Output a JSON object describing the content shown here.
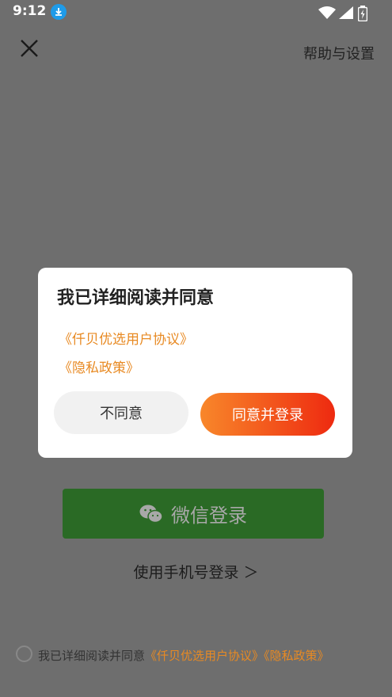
{
  "status_bar": {
    "time": "9:12"
  },
  "header": {
    "help_label": "帮助与设置"
  },
  "dialog": {
    "title": "我已详细阅读并同意",
    "link_user_agreement": "《仟贝优选用户协议》",
    "link_privacy_policy": "《隐私政策》",
    "disagree_label": "不同意",
    "agree_label": "同意并登录"
  },
  "login": {
    "wechat_label": "微信登录",
    "phone_label": "使用手机号登录 ＞"
  },
  "footer": {
    "agreement_prefix": "我已详细阅读并同意",
    "link_user_agreement": "《仟贝优选用户协议》",
    "link_privacy_policy": "《隐私政策》"
  },
  "colors": {
    "accent_orange": "#e88a23",
    "agree_gradient_start": "#f8872a",
    "agree_gradient_end": "#ee2a10",
    "wechat_green": "#2a6a25",
    "overlay": "#6e6e6e"
  },
  "icons": [
    "download-icon",
    "wifi-icon",
    "signal-icon",
    "battery-icon",
    "close-icon",
    "wechat-icon"
  ]
}
